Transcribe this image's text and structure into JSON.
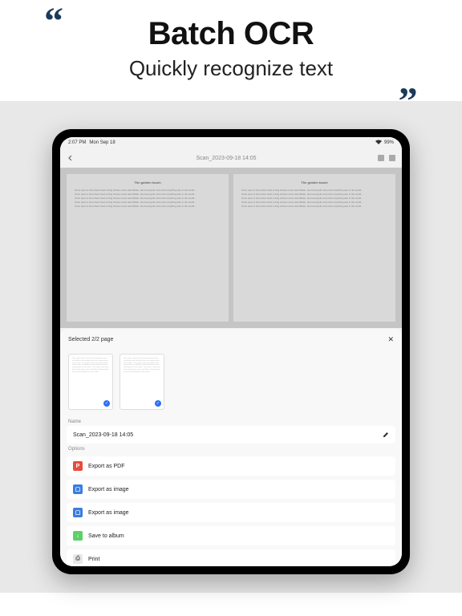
{
  "header": {
    "title": "Batch OCR",
    "subtitle": "Quickly recognize text"
  },
  "status": {
    "time": "2:07 PM",
    "date": "Mon Sep 18",
    "battery": "99%"
  },
  "app_header": {
    "title": "Scan_2023-09-18 14:05"
  },
  "doc_pages": {
    "title": "The golden touch",
    "para": "Once upon a time there lived a king whose name was Midas. He loved gold more than anything else in the world..."
  },
  "sheet": {
    "selected_label": "Selected 2/2 page",
    "name_label": "Name",
    "name_value": "Scan_2023-09-18 14:05",
    "options_label": "Options",
    "options": [
      {
        "label": "Export as PDF"
      },
      {
        "label": "Export as image"
      },
      {
        "label": "Export as image"
      },
      {
        "label": "Save to album"
      },
      {
        "label": "Print"
      }
    ]
  }
}
